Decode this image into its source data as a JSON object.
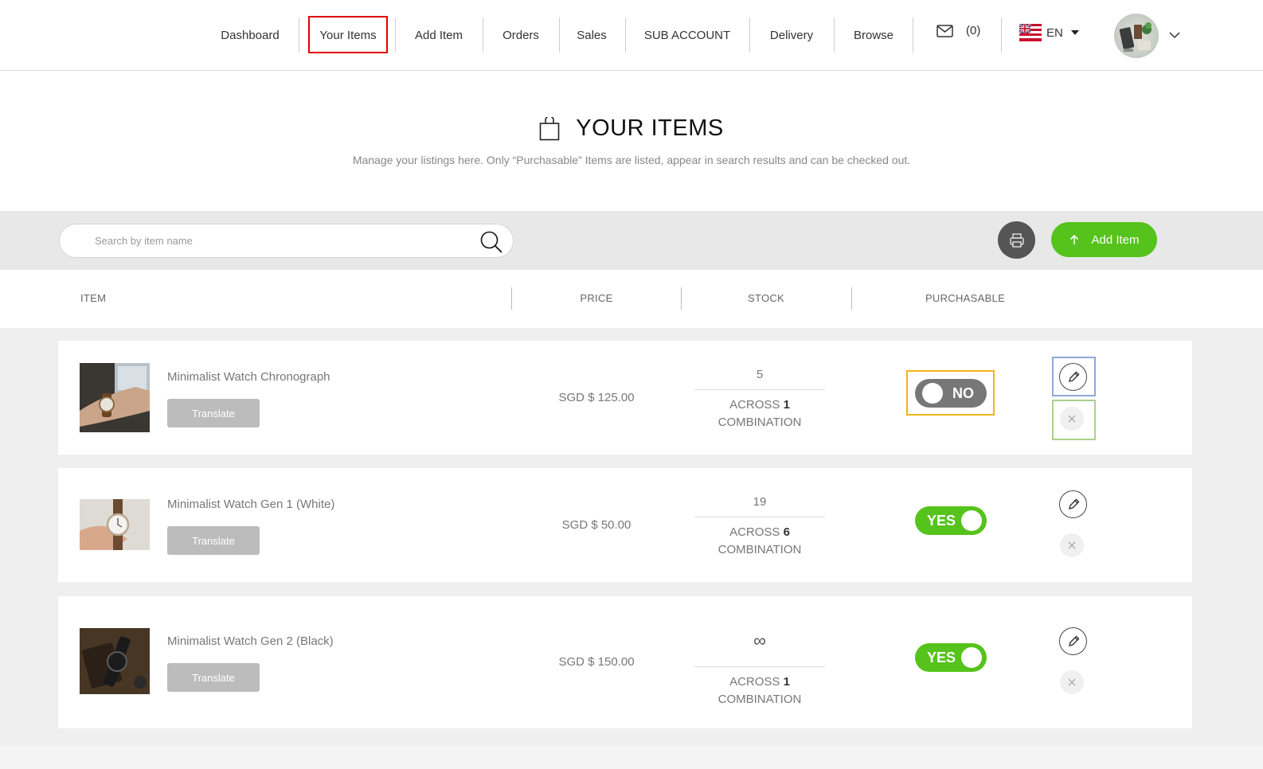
{
  "nav": {
    "items": [
      {
        "label": "Dashboard"
      },
      {
        "label": "Your Items"
      },
      {
        "label": "Add Item"
      },
      {
        "label": "Orders"
      },
      {
        "label": "Sales"
      },
      {
        "label": "SUB ACCOUNT"
      },
      {
        "label": "Delivery"
      },
      {
        "label": "Browse"
      }
    ],
    "active": "Your Items",
    "inbox_count": "(0)",
    "language": "EN"
  },
  "header": {
    "title": "YOUR ITEMS",
    "subtitle": "Manage your listings here. Only “Purchasable” Items are listed, appear in search results and can be checked out."
  },
  "toolbar": {
    "search_placeholder": "Search by item name",
    "add_item_label": "Add Item"
  },
  "table": {
    "columns": [
      "ITEM",
      "PRICE",
      "STOCK",
      "PURCHASABLE"
    ],
    "rows": [
      {
        "name": "Minimalist Watch Chronograph",
        "translate_label": "Translate",
        "price": "SGD $ 125.00",
        "stock": "5",
        "across_prefix": "ACROSS ",
        "combinations": "1",
        "combination_label": "COMBINATION",
        "purchasable": false,
        "purchasable_label": "NO"
      },
      {
        "name": "Minimalist Watch Gen 1 (White)",
        "translate_label": "Translate",
        "price": "SGD $ 50.00",
        "stock": "19",
        "across_prefix": "ACROSS ",
        "combinations": "6",
        "combination_label": "COMBINATION",
        "purchasable": true,
        "purchasable_label": "YES"
      },
      {
        "name": "Minimalist Watch Gen 2 (Black)",
        "translate_label": "Translate",
        "price": "SGD $ 150.00",
        "stock": "∞",
        "across_prefix": "ACROSS ",
        "combinations": "1",
        "combination_label": "COMBINATION",
        "purchasable": true,
        "purchasable_label": "YES"
      }
    ]
  },
  "colors": {
    "accent_green": "#55c31b",
    "toggle_off": "#777777",
    "highlight_red": "#e00000",
    "highlight_yellow": "#f4b41a",
    "highlight_blue": "#8fa8d8",
    "highlight_green": "#a9d18e"
  },
  "icons": {
    "mail": "envelope-icon",
    "flag": "uk-flag-icon",
    "search": "search-icon",
    "print": "print-icon",
    "add": "arrow-up-icon",
    "edit": "pencil-icon",
    "delete": "close-icon",
    "title": "shopping-bag-icon"
  }
}
